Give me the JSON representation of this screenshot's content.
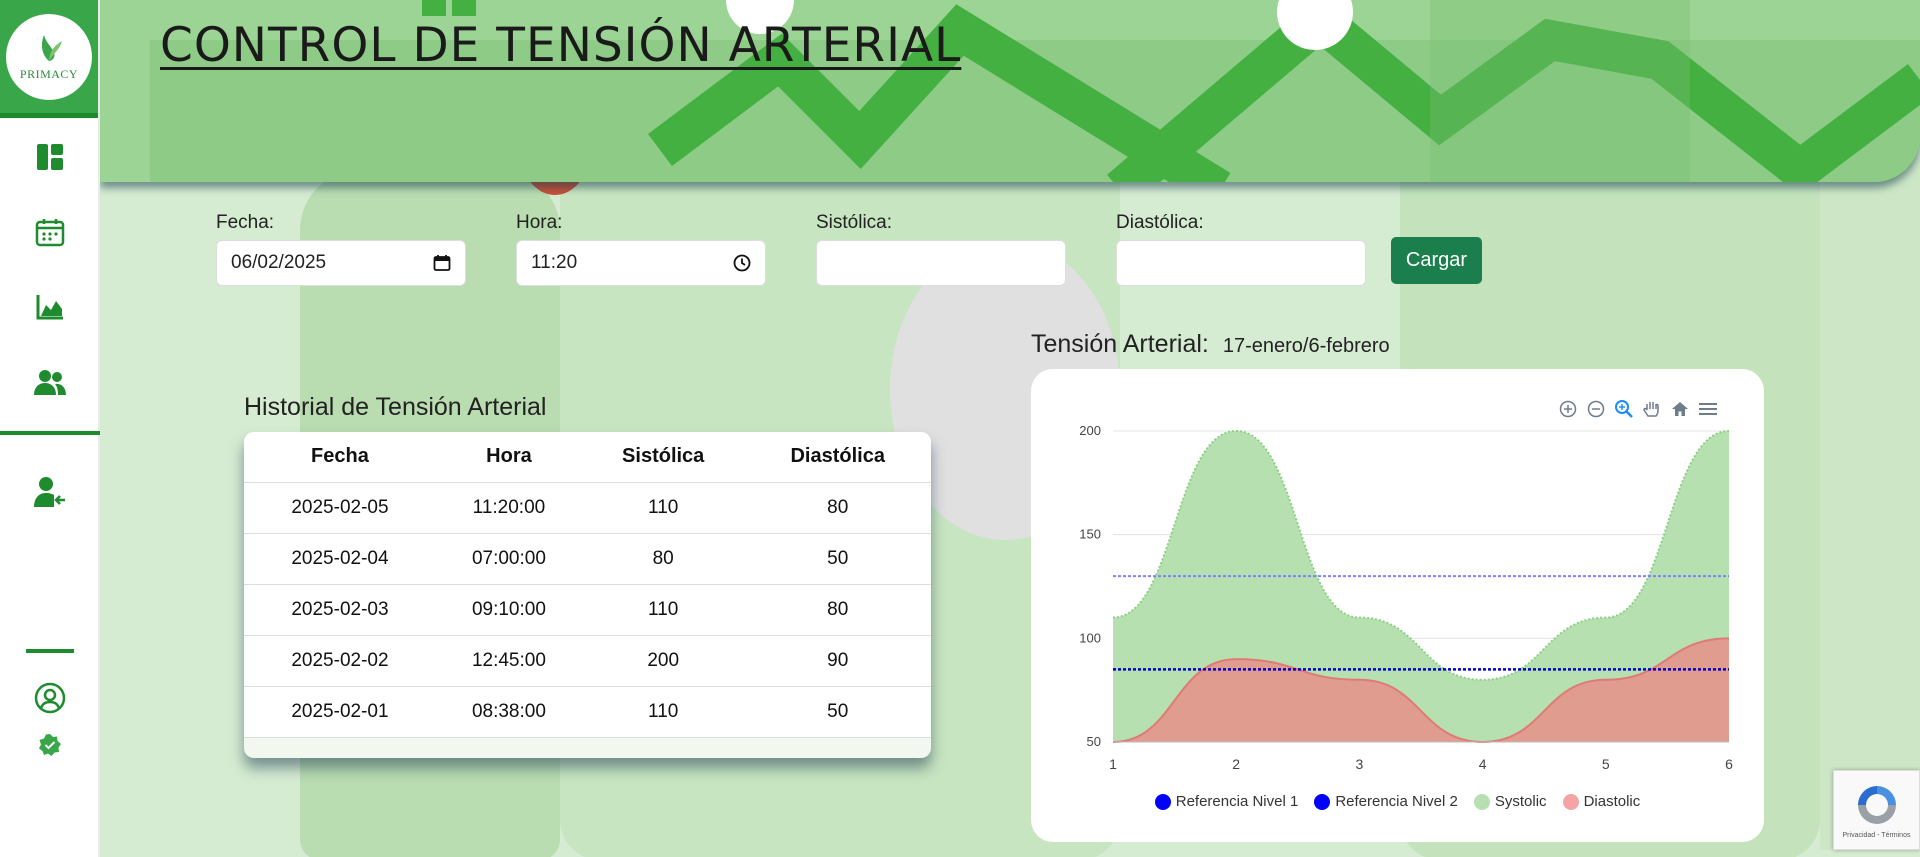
{
  "app": {
    "logo_text": "PRIMACY"
  },
  "page_title": "CONTROL DE TENSIÓN ARTERIAL",
  "sidebar": {
    "items": [
      {
        "icon": "dashboard-icon"
      },
      {
        "icon": "calendar-icon"
      },
      {
        "icon": "area-chart-icon"
      },
      {
        "icon": "users-icon"
      },
      {
        "icon": "user-return-icon"
      },
      {
        "icon": "user-circle-icon"
      },
      {
        "icon": "verified-badge-icon"
      }
    ]
  },
  "form": {
    "fecha_label": "Fecha:",
    "fecha_value": "06/02/2025",
    "hora_label": "Hora:",
    "hora_value": "11:20",
    "sistolica_label": "Sistólica:",
    "sistolica_value": "",
    "diastolica_label": "Diastólica:",
    "diastolica_value": "",
    "submit_label": "Cargar"
  },
  "history": {
    "title": "Historial de Tensión Arterial",
    "columns": [
      "Fecha",
      "Hora",
      "Sistólica",
      "Diastólica"
    ],
    "rows": [
      [
        "2025-02-05",
        "11:20:00",
        "110",
        "80"
      ],
      [
        "2025-02-04",
        "07:00:00",
        "80",
        "50"
      ],
      [
        "2025-02-03",
        "09:10:00",
        "110",
        "80"
      ],
      [
        "2025-02-02",
        "12:45:00",
        "200",
        "90"
      ],
      [
        "2025-02-01",
        "08:38:00",
        "110",
        "50"
      ]
    ]
  },
  "chart_header": {
    "title": "Tensión Arterial:",
    "range": "17-enero/6-febrero"
  },
  "recaptcha": {
    "text": "Privacidad - Términos"
  },
  "colors": {
    "accent": "#1e8c2e",
    "button": "#1b7f4d",
    "systolic": "#a9dba3",
    "diastolic": "#f4a4a4",
    "ref1": "#0000ff",
    "ref2": "#0000ff"
  },
  "chart_data": {
    "type": "area",
    "x": [
      1,
      2,
      3,
      4,
      5,
      6
    ],
    "ylim": [
      50,
      200
    ],
    "yticks": [
      50,
      100,
      150,
      200
    ],
    "series": [
      {
        "name": "Referencia Nivel 1",
        "type": "line",
        "values": [
          130,
          130,
          130,
          130,
          130,
          130
        ],
        "color": "#8080ff"
      },
      {
        "name": "Referencia Nivel 2",
        "type": "line",
        "values": [
          85,
          85,
          85,
          85,
          85,
          85
        ],
        "color": "#0000cc"
      },
      {
        "name": "Systolic",
        "type": "area",
        "values": [
          110,
          200,
          110,
          80,
          110,
          200
        ],
        "color": "#a9dba3"
      },
      {
        "name": "Diastolic",
        "type": "area",
        "values": [
          50,
          90,
          80,
          50,
          80,
          100
        ],
        "color": "#f4a4a4"
      }
    ],
    "legend_position": "bottom",
    "grid": true
  }
}
